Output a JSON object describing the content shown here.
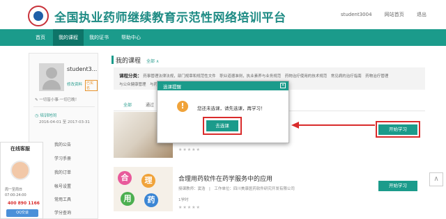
{
  "header": {
    "site_title": "全国执业药师继续教育示范性网络培训平台",
    "username": "student3004",
    "home_link": "网站首页",
    "logout": "退出"
  },
  "nav": {
    "items": [
      "首页",
      "我的课程",
      "我的证书",
      "帮助中心"
    ],
    "active": "我的课程"
  },
  "sidebar": {
    "username": "student3...",
    "edit_link": "修改资料",
    "vip_badge": "已实名",
    "motto": "一切皆小事·一切已晚！",
    "train_label": "培训时间",
    "train_date": "2016-04-01 至 2017-03-31",
    "menu": [
      "我的公告",
      "学习手册",
      "我的订单",
      "帐号设置",
      "常用工具",
      "学分查询"
    ]
  },
  "kefu": {
    "title": "在线客服",
    "time1": "周一至周日",
    "time2": "07:00-24:00",
    "phone": "400 890 1166",
    "qq": "QQ交谈"
  },
  "main": {
    "title": "我的课程",
    "all_link": "全部 ∧",
    "category_label": "课程分类：",
    "categories_line1": "药事管理法律法规，部门规章和规范性文件　职业道德准则，执业素养与业务规范　药物治疗使用的技术规范　常见病的治疗指南　药物治疗管理",
    "categories_line2": "与公众健康管理　与药学服务相关的……　信息技术与…… 方法　药学服务信息技术应用知识",
    "tabs": [
      "全部",
      "通过"
    ],
    "course2_title": "合理用药软件在药学服务中的应用",
    "course2_meta": "授课教师：窦浩　|　工作单位：四川美康医药软件研究开发有限公司",
    "course2_hours": "1学时",
    "stars": "★★★★★",
    "start_button": "开始学习",
    "img2_chars": [
      "合",
      "理",
      "用",
      "药"
    ]
  },
  "dialog": {
    "title": "选课提醒",
    "close": "×",
    "message": "您还未选课，请先选课，再学习！",
    "button": "去选课"
  },
  "scroll_up": "∧"
}
